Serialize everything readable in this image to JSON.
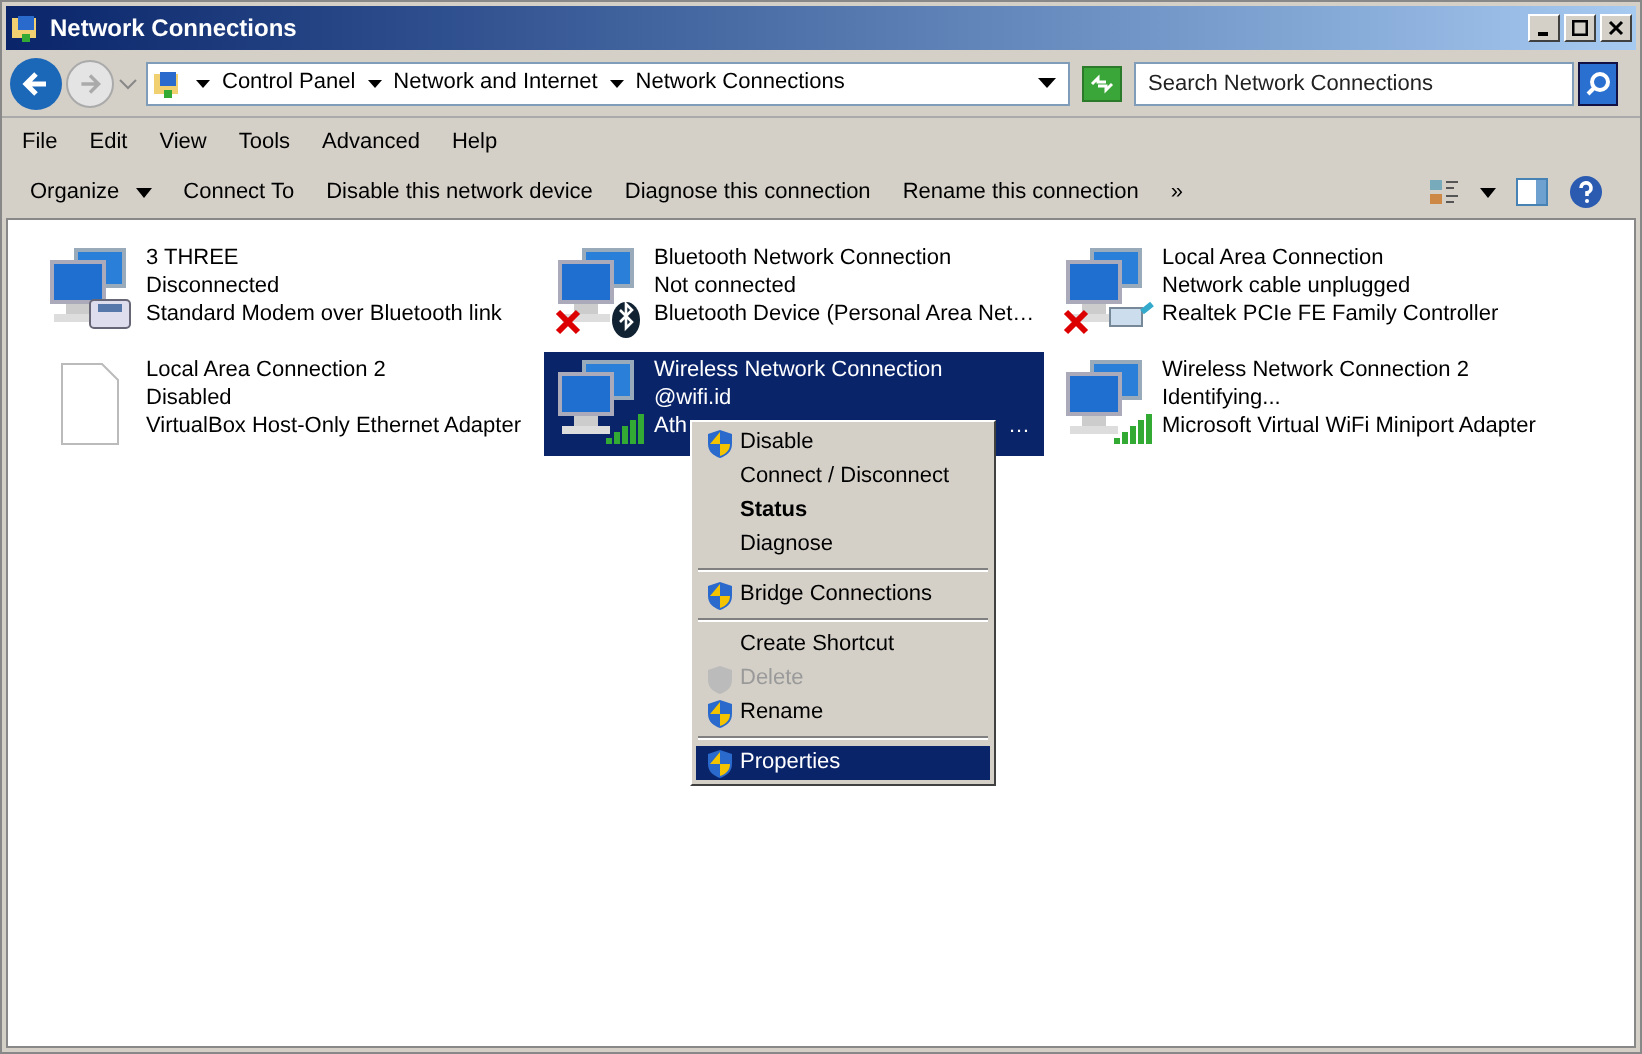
{
  "window": {
    "title": "Network Connections"
  },
  "address": {
    "crumbs": [
      "Control Panel",
      "Network and Internet",
      "Network Connections"
    ]
  },
  "search": {
    "placeholder": "Search Network Connections"
  },
  "menu_bar": [
    "File",
    "Edit",
    "View",
    "Tools",
    "Advanced",
    "Help"
  ],
  "command_bar": [
    {
      "label": "Organize",
      "dropdown": true
    },
    {
      "label": "Connect To",
      "dropdown": false
    },
    {
      "label": "Disable this network device",
      "dropdown": false
    },
    {
      "label": "Diagnose this connection",
      "dropdown": false
    },
    {
      "label": "Rename this connection",
      "dropdown": false
    },
    {
      "label": "»",
      "dropdown": false
    }
  ],
  "connections": [
    {
      "name": "3 THREE",
      "status": "Disconnected",
      "device": "Standard Modem over Bluetooth link",
      "kind": "modem",
      "error": false,
      "selected": false
    },
    {
      "name": "Bluetooth Network Connection",
      "status": "Not connected",
      "device": "Bluetooth Device (Personal Area Net…",
      "kind": "bluetooth",
      "error": true,
      "selected": false
    },
    {
      "name": "Local Area Connection",
      "status": "Network cable unplugged",
      "device": "Realtek PCIe FE Family Controller",
      "kind": "cable",
      "error": true,
      "selected": false
    },
    {
      "name": "Local Area Connection 2",
      "status": "Disabled",
      "device": "VirtualBox Host-Only Ethernet Adapter",
      "kind": "blank",
      "error": false,
      "selected": false
    },
    {
      "name": "Wireless Network Connection",
      "status": "@wifi.id",
      "device": "Ath",
      "device_end": "…",
      "kind": "wireless",
      "error": false,
      "selected": true
    },
    {
      "name": "Wireless Network Connection 2",
      "status": "Identifying...",
      "device": "Microsoft Virtual WiFi Miniport Adapter",
      "kind": "wireless",
      "error": false,
      "selected": false
    }
  ],
  "context_menu": [
    {
      "kind": "item",
      "label": "Disable",
      "shield": true,
      "bold": false,
      "disabled": false,
      "selected": false
    },
    {
      "kind": "item",
      "label": "Connect / Disconnect",
      "shield": false,
      "bold": false,
      "disabled": false,
      "selected": false
    },
    {
      "kind": "item",
      "label": "Status",
      "shield": false,
      "bold": true,
      "disabled": false,
      "selected": false
    },
    {
      "kind": "item",
      "label": "Diagnose",
      "shield": false,
      "bold": false,
      "disabled": false,
      "selected": false
    },
    {
      "kind": "separator"
    },
    {
      "kind": "item",
      "label": "Bridge Connections",
      "shield": true,
      "bold": false,
      "disabled": false,
      "selected": false
    },
    {
      "kind": "separator"
    },
    {
      "kind": "item",
      "label": "Create Shortcut",
      "shield": false,
      "bold": false,
      "disabled": false,
      "selected": false
    },
    {
      "kind": "item",
      "label": "Delete",
      "shield": true,
      "bold": false,
      "disabled": true,
      "selected": false
    },
    {
      "kind": "item",
      "label": "Rename",
      "shield": true,
      "bold": false,
      "disabled": false,
      "selected": false
    },
    {
      "kind": "separator"
    },
    {
      "kind": "item",
      "label": "Properties",
      "shield": true,
      "bold": false,
      "disabled": false,
      "selected": true
    }
  ]
}
